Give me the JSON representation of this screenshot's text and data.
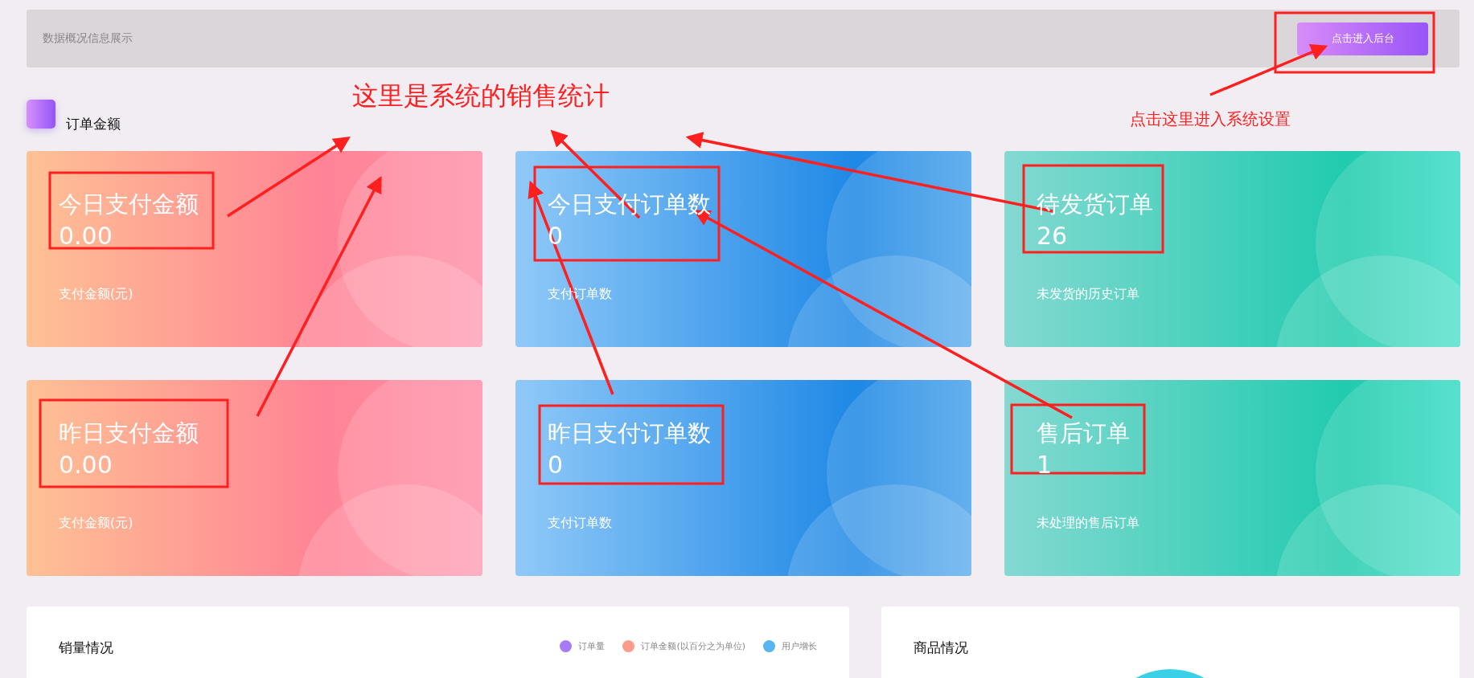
{
  "header": {
    "title": "数据概况信息展示",
    "button": "点击进入后台"
  },
  "section": {
    "title": "订单金额"
  },
  "cards": [
    {
      "kind": "pink",
      "title": "今日支付金额",
      "value": "0.00",
      "caption": "支付金额(元)"
    },
    {
      "kind": "blue",
      "title": "今日支付订单数",
      "value": "0",
      "caption": "支付订单数"
    },
    {
      "kind": "teal",
      "title": "待发货订单",
      "value": "26",
      "caption": "未发货的历史订单"
    },
    {
      "kind": "pink",
      "title": "昨日支付金额",
      "value": "0.00",
      "caption": "支付金额(元)"
    },
    {
      "kind": "blue",
      "title": "昨日支付订单数",
      "value": "0",
      "caption": "支付订单数"
    },
    {
      "kind": "teal",
      "title": "售后订单",
      "value": "1",
      "caption": "未处理的售后订单"
    }
  ],
  "sales_panel": {
    "title": "销量情况",
    "legend": [
      {
        "label": "订单量",
        "color": "#a77af7"
      },
      {
        "label": "订单金额(以百分之为单位)",
        "color": "#fe9a8b"
      },
      {
        "label": "用户增长",
        "color": "#56b5f0"
      }
    ]
  },
  "goods_panel": {
    "title": "商品情况"
  },
  "annotations": {
    "headline": "这里是系统的销售统计",
    "note": "点击这里进入系统设置"
  }
}
